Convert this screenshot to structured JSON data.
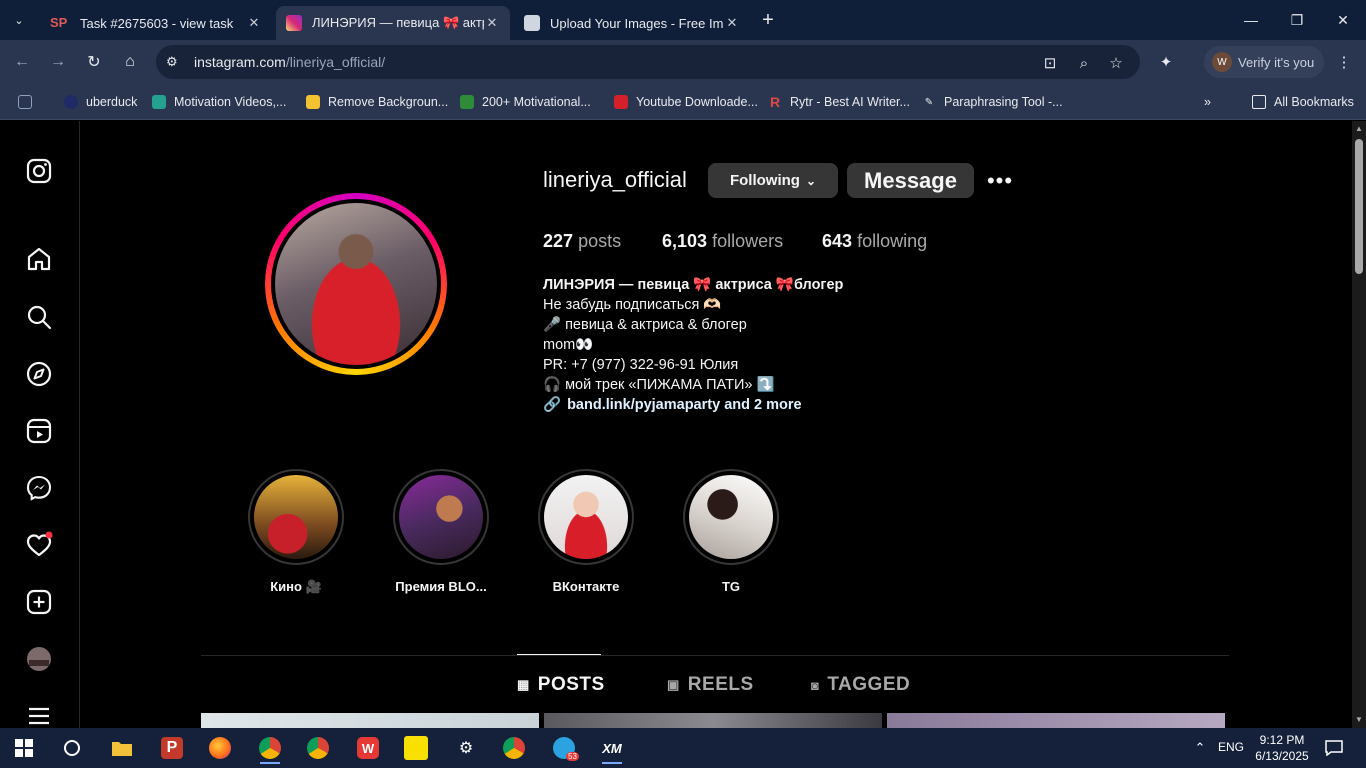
{
  "browser": {
    "tabs": [
      {
        "title": "Task #2675603 - view task",
        "favicon_text": "SP",
        "active": false
      },
      {
        "title": "ЛИНЭРИЯ — певица 🎀 актриса",
        "active": true
      },
      {
        "title": "Upload Your Images - Free Imag",
        "active": false
      }
    ],
    "url_host": "instagram.com",
    "url_path": "/lineriya_official/",
    "verify_label": "Verify it's you",
    "verify_avatar": "W",
    "bookmarks": [
      "uberduck",
      "Motivation Videos,...",
      "Remove Backgroun...",
      "200+ Motivational...",
      "Youtube Downloade...",
      "Rytr - Best AI Writer...",
      "Paraphrasing Tool -..."
    ],
    "bookmarks_folder": "All Bookmarks"
  },
  "profile": {
    "username": "lineriya_official",
    "following_label": "Following",
    "message_label": "Message",
    "posts_count": "227",
    "posts_label": "posts",
    "followers_count": "6,103",
    "followers_label": "followers",
    "following_count": "643",
    "following_count_label": "following",
    "bio": {
      "name": "ЛИНЭРИЯ — певица 🎀 актриса 🎀блогер",
      "line1": "Не забудь подписаться 🫶🏻",
      "line2": "🎤 певица & актриса & блогер",
      "line3": "mom👀",
      "line4": "PR: +7 (977) 322-96-91 Юлия",
      "line5": "🎧 мой трек «ПИЖАМА ПАТИ» ⤵️",
      "link": "band.link/pyjamaparty and 2 more"
    },
    "highlights": [
      {
        "label": "Кино 🎥"
      },
      {
        "label": "Премия BLO..."
      },
      {
        "label": "ВКонтакте"
      },
      {
        "label": "TG"
      }
    ],
    "tabs": [
      {
        "label": "POSTS",
        "active": true
      },
      {
        "label": "REELS",
        "active": false
      },
      {
        "label": "TAGGED",
        "active": false
      }
    ]
  },
  "taskbar": {
    "lang": "ENG",
    "time": "9:12 PM",
    "date": "6/13/2025",
    "telegram_badge": "53"
  }
}
